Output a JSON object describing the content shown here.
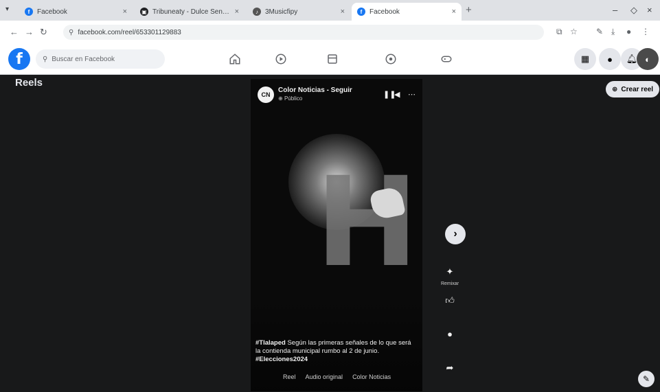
{
  "browser": {
    "tabs": [
      {
        "title": "Facebook",
        "favicon_color": "#1877f2",
        "favicon_letter": "f"
      },
      {
        "title": "Tribuneaty - Dulce Senderos",
        "favicon_color": "#202124",
        "favicon_letter": "▣"
      },
      {
        "title": "3Musicfipy",
        "favicon_color": "#555555",
        "favicon_letter": "♪"
      },
      {
        "title": "Facebook",
        "favicon_color": "#1877f2",
        "favicon_letter": "f"
      }
    ],
    "url": "facebook.com/reel/653301129883"
  },
  "facebook": {
    "logo": "f",
    "search_placeholder": "Buscar en Facebook"
  },
  "reels": {
    "page_title": "Reels",
    "create_label": "Crear reel",
    "channel_initials": "CN",
    "channel_name": "Color Noticias - Seguir",
    "channel_sub": "Público",
    "caption_hashtag": "#Tlalaped",
    "caption_text": " Según las primeras señales de lo que será la contienda municipal rumbo al 2 de junio.",
    "caption_hashtag2": "#Elecciones2024",
    "audio_meta": "Reel",
    "audio_label": "Audio original",
    "audio_channel": "Color Noticias",
    "remix_label": "Remixar"
  },
  "colors": {
    "background": "#18191a",
    "fb_blue": "#1877f2"
  }
}
